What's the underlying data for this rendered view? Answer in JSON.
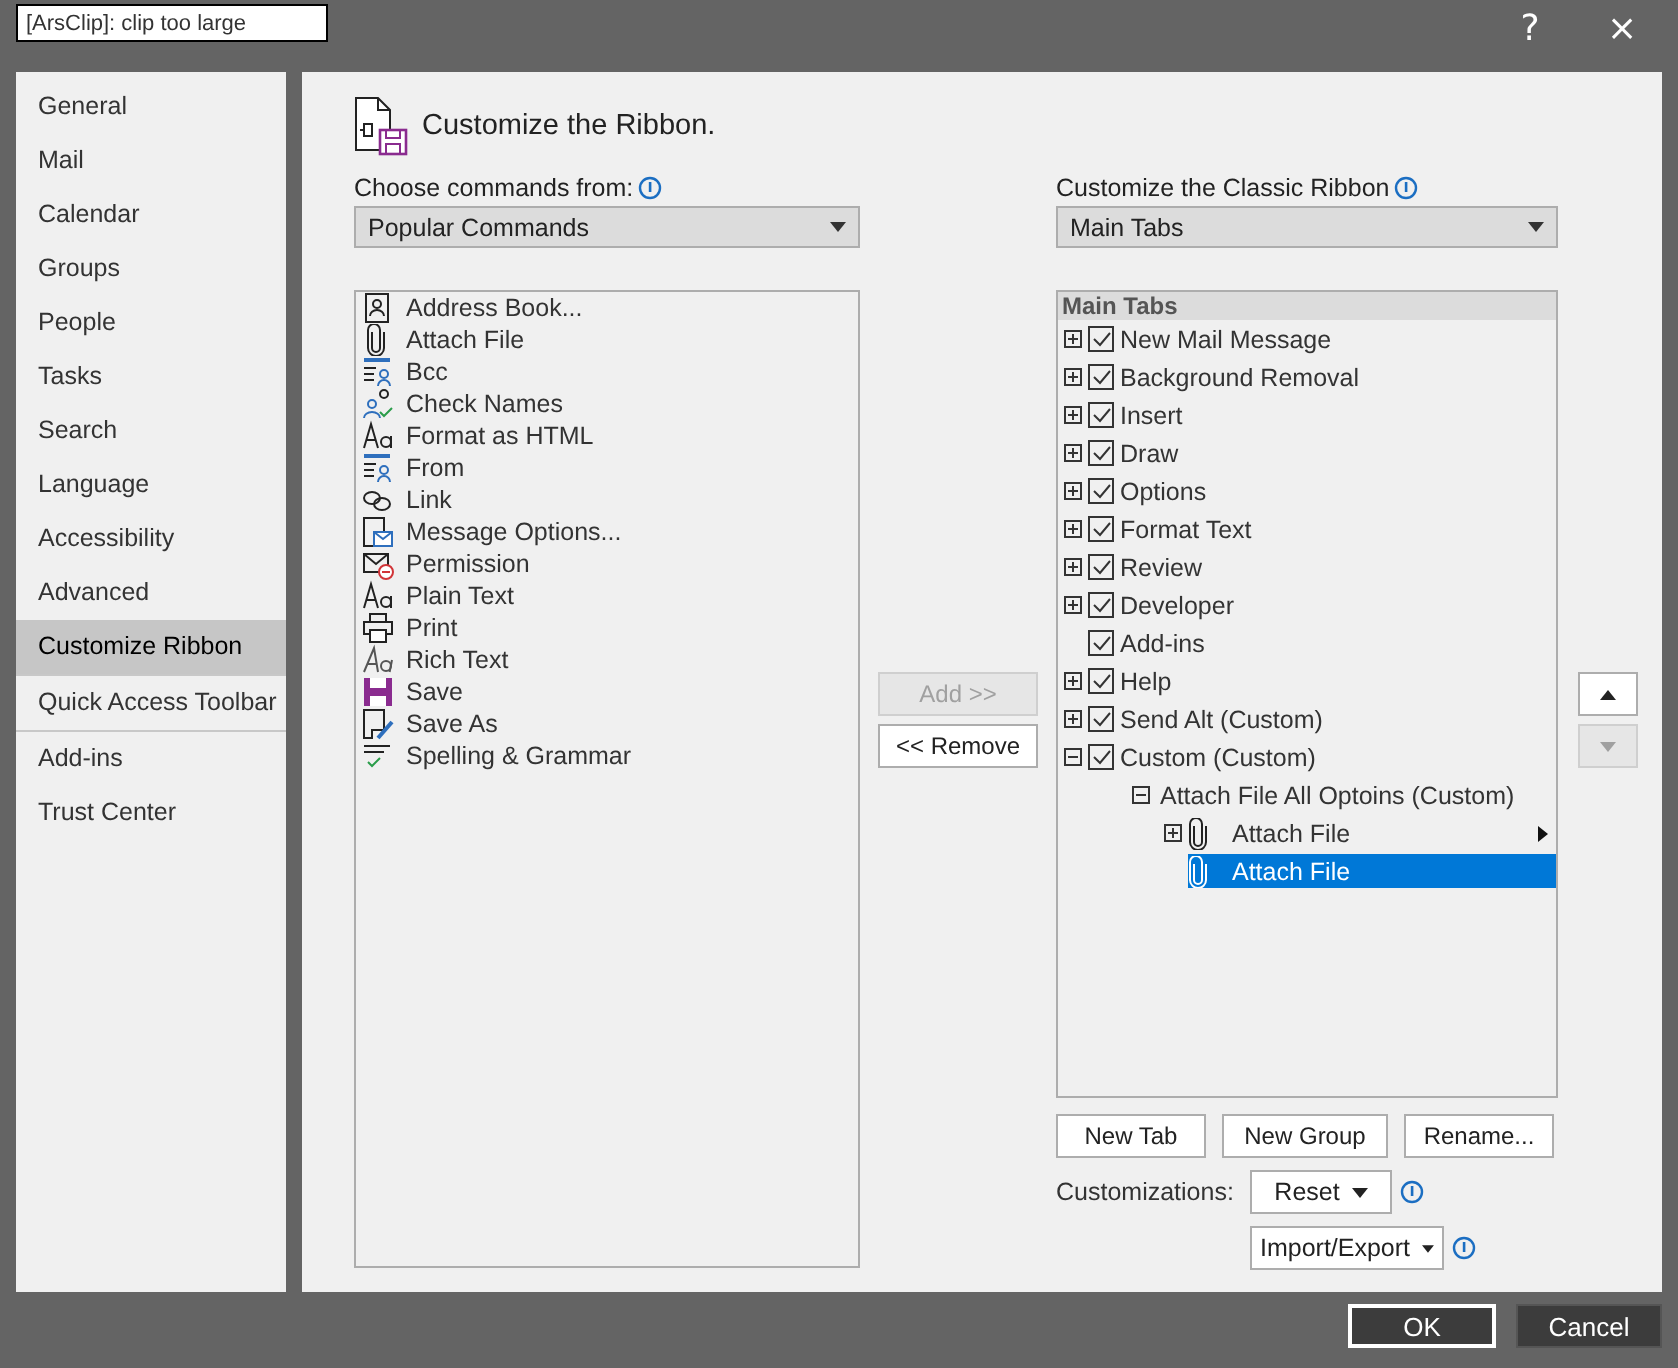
{
  "title_field": {
    "value": "[ArsClip]: clip too large"
  },
  "title_buttons": [
    "?",
    "×"
  ],
  "sidebar": {
    "items": [
      {
        "label": "General",
        "selected": false
      },
      {
        "label": "Mail",
        "selected": false
      },
      {
        "label": "Calendar",
        "selected": false
      },
      {
        "label": "Groups",
        "selected": false
      },
      {
        "label": "People",
        "selected": false
      },
      {
        "label": "Tasks",
        "selected": false
      },
      {
        "label": "Search",
        "selected": false
      },
      {
        "label": "Language",
        "selected": false
      },
      {
        "label": "Accessibility",
        "selected": false
      },
      {
        "label": "Advanced",
        "selected": false
      },
      {
        "label": "Customize Ribbon",
        "selected": true
      },
      {
        "label": "Quick Access Toolbar",
        "selected": false
      },
      {
        "label": "Add-ins",
        "selected": false
      },
      {
        "label": "Trust Center",
        "selected": false
      }
    ]
  },
  "heading": "Customize the Ribbon.",
  "commands_from": {
    "label": "Choose commands from:",
    "value": "Popular Commands"
  },
  "commands": [
    {
      "label": "Address Book..."
    },
    {
      "label": "Attach File"
    },
    {
      "label": "Bcc"
    },
    {
      "label": "Check Names"
    },
    {
      "label": "Format as HTML"
    },
    {
      "label": "From"
    },
    {
      "label": "Link"
    },
    {
      "label": "Message Options..."
    },
    {
      "label": "Permission"
    },
    {
      "label": "Plain Text"
    },
    {
      "label": "Print"
    },
    {
      "label": "Rich Text"
    },
    {
      "label": "Save"
    },
    {
      "label": "Save As"
    },
    {
      "label": "Spelling & Grammar"
    }
  ],
  "add_button": {
    "label": "Add >>",
    "disabled": true
  },
  "remove_button": {
    "label": "<< Remove",
    "disabled": false
  },
  "customize_ribbon": {
    "label": "Customize the Classic Ribbon",
    "value": "Main Tabs"
  },
  "tree": {
    "header": "Main Tabs",
    "items": [
      {
        "kind": "tab",
        "label": "New Mail Message",
        "expanded": false,
        "checked": true
      },
      {
        "kind": "tab",
        "label": "Background Removal",
        "expanded": false,
        "checked": true
      },
      {
        "kind": "tab",
        "label": "Insert",
        "expanded": false,
        "checked": true
      },
      {
        "kind": "tab",
        "label": "Draw",
        "expanded": false,
        "checked": true
      },
      {
        "kind": "tab",
        "label": "Options",
        "expanded": false,
        "checked": true
      },
      {
        "kind": "tab",
        "label": "Format Text",
        "expanded": false,
        "checked": true
      },
      {
        "kind": "tab",
        "label": "Review",
        "expanded": false,
        "checked": true
      },
      {
        "kind": "tab",
        "label": "Developer",
        "expanded": false,
        "checked": true
      },
      {
        "kind": "leaf",
        "label": "Add-ins",
        "checked": true
      },
      {
        "kind": "tab",
        "label": "Help",
        "expanded": false,
        "checked": true
      },
      {
        "kind": "tab",
        "label": "Send Alt (Custom)",
        "expanded": false,
        "checked": true
      },
      {
        "kind": "tab",
        "label": "Custom (Custom)",
        "expanded": true,
        "checked": true,
        "children": [
          {
            "kind": "group",
            "label": "Attach File All Optoins (Custom)",
            "expanded": true,
            "children": [
              {
                "kind": "command",
                "label": "Attach File",
                "expanded": false,
                "submenu": true,
                "selected": false
              },
              {
                "kind": "command",
                "label": "Attach File",
                "selected": true
              }
            ]
          }
        ]
      }
    ]
  },
  "move_up": {
    "disabled": false
  },
  "move_down": {
    "disabled": true
  },
  "tree_buttons": [
    "New Tab",
    "New Group",
    "Rename..."
  ],
  "customizations": {
    "label": "Customizations:",
    "reset": "Reset",
    "import_export": "Import/Export"
  },
  "footer_buttons": [
    {
      "label": "OK",
      "default": true
    },
    {
      "label": "Cancel",
      "default": false
    }
  ]
}
